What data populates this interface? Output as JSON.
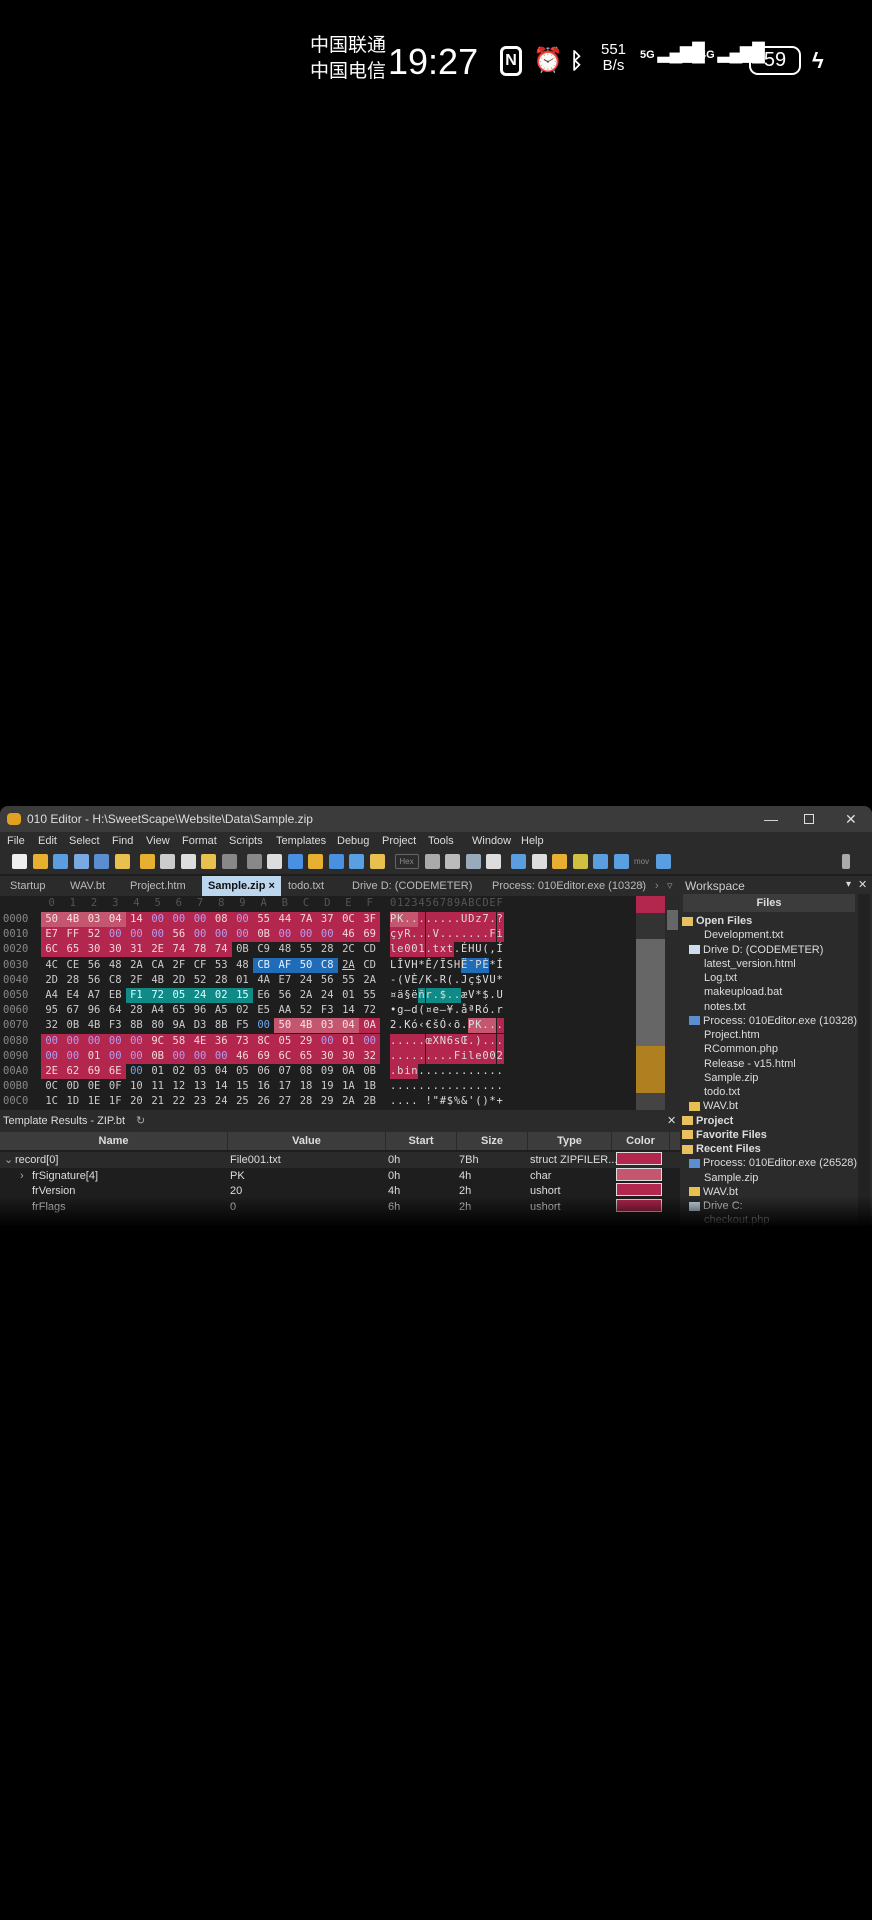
{
  "status_bar": {
    "carrier1": "中国联通",
    "carrier2": "中国电信",
    "time": "19:27",
    "net_speed_value": "551",
    "net_speed_unit": "B/s",
    "sig1": "5G",
    "sig2": "4G",
    "battery": "59"
  },
  "window": {
    "title": "010 Editor - H:\\SweetScape\\Website\\Data\\Sample.zip"
  },
  "menu": [
    "File",
    "Edit",
    "Select",
    "Find",
    "View",
    "Format",
    "Scripts",
    "Templates",
    "Debug",
    "Project",
    "Tools",
    "Window",
    "Help"
  ],
  "toolbar": {
    "hex_label": "Hex",
    "mov_label": "mov"
  },
  "tabs": [
    {
      "label": "Startup"
    },
    {
      "label": "WAV.bt"
    },
    {
      "label": "Project.htm"
    },
    {
      "label": "Sample.zip ×",
      "active": true
    },
    {
      "label": "todo.txt"
    },
    {
      "label": "Drive D: (CODEMETER)"
    },
    {
      "label": "Process: 010Editor.exe (10328)"
    }
  ],
  "hex": {
    "col_header": [
      "0",
      "1",
      "2",
      "3",
      "4",
      "5",
      "6",
      "7",
      "8",
      "9",
      "A",
      "B",
      "C",
      "D",
      "E",
      "F"
    ],
    "text_header": "0123456789ABCDEF",
    "rows": [
      {
        "offset": "0000",
        "bytes": [
          "50",
          "4B",
          "03",
          "04",
          "14",
          "00",
          "00",
          "00",
          "08",
          "00",
          "55",
          "44",
          "7A",
          "37",
          "0C",
          "3F"
        ],
        "text": "PK........UDz7.?"
      },
      {
        "offset": "0010",
        "bytes": [
          "E7",
          "FF",
          "52",
          "00",
          "00",
          "00",
          "56",
          "00",
          "00",
          "00",
          "0B",
          "00",
          "00",
          "00",
          "46",
          "69"
        ],
        "text": "çyR...V.......Fi"
      },
      {
        "offset": "0020",
        "bytes": [
          "6C",
          "65",
          "30",
          "30",
          "31",
          "2E",
          "74",
          "78",
          "74",
          "0B",
          "C9",
          "48",
          "55",
          "28",
          "2C",
          "CD"
        ],
        "text": "le001.txt.ÉHU(,Í"
      },
      {
        "offset": "0030",
        "bytes": [
          "4C",
          "CE",
          "56",
          "48",
          "2A",
          "CA",
          "2F",
          "CF",
          "53",
          "48",
          "CB",
          "AF",
          "50",
          "C8",
          "2A",
          "CD"
        ],
        "text": "LÎVH*Ê/ÏSHË¯PÈ*Í"
      },
      {
        "offset": "0040",
        "bytes": [
          "2D",
          "28",
          "56",
          "C8",
          "2F",
          "4B",
          "2D",
          "52",
          "28",
          "01",
          "4A",
          "E7",
          "24",
          "56",
          "55",
          "2A"
        ],
        "text": "-(VÈ/K-R(.Jç$VU*"
      },
      {
        "offset": "0050",
        "bytes": [
          "A4",
          "E4",
          "A7",
          "EB",
          "F1",
          "72",
          "05",
          "24",
          "02",
          "15",
          "E6",
          "56",
          "2A",
          "24",
          "01",
          "55"
        ],
        "text": "¤ä§ëñr.$..æV*$.U"
      },
      {
        "offset": "0060",
        "bytes": [
          "95",
          "67",
          "96",
          "64",
          "28",
          "A4",
          "65",
          "96",
          "A5",
          "02",
          "E5",
          "AA",
          "52",
          "F3",
          "14",
          "72"
        ],
        "text": "•g–d(¤e–¥.åªRó.r"
      },
      {
        "offset": "0070",
        "bytes": [
          "32",
          "0B",
          "4B",
          "F3",
          "8B",
          "80",
          "9A",
          "D3",
          "8B",
          "F5",
          "00",
          "50",
          "4B",
          "03",
          "04",
          "0A"
        ],
        "text": "2.Kó‹€šÓ‹õ.PK..."
      },
      {
        "offset": "0080",
        "bytes": [
          "00",
          "00",
          "00",
          "00",
          "00",
          "9C",
          "58",
          "4E",
          "36",
          "73",
          "8C",
          "05",
          "29",
          "00",
          "01",
          "00"
        ],
        "text": ".....œXN6sŒ.)..."
      },
      {
        "offset": "0090",
        "bytes": [
          "00",
          "00",
          "01",
          "00",
          "00",
          "0B",
          "00",
          "00",
          "00",
          "46",
          "69",
          "6C",
          "65",
          "30",
          "30",
          "32"
        ],
        "text": ".........File002"
      },
      {
        "offset": "00A0",
        "bytes": [
          "2E",
          "62",
          "69",
          "6E",
          "00",
          "01",
          "02",
          "03",
          "04",
          "05",
          "06",
          "07",
          "08",
          "09",
          "0A",
          "0B"
        ],
        "text": ".bin............"
      },
      {
        "offset": "00B0",
        "bytes": [
          "0C",
          "0D",
          "0E",
          "0F",
          "10",
          "11",
          "12",
          "13",
          "14",
          "15",
          "16",
          "17",
          "18",
          "19",
          "1A",
          "1B"
        ],
        "text": "................"
      },
      {
        "offset": "00C0",
        "bytes": [
          "1C",
          "1D",
          "1E",
          "1F",
          "20",
          "21",
          "22",
          "23",
          "24",
          "25",
          "26",
          "27",
          "28",
          "29",
          "2A",
          "2B"
        ],
        "text": ".... !\"#$%&'()*+"
      }
    ],
    "highlights": [
      {
        "row": 0,
        "from": 0,
        "to": 3,
        "kind": "lpink"
      },
      {
        "row": 0,
        "from": 4,
        "to": 15,
        "kind": "pink"
      },
      {
        "row": 1,
        "from": 0,
        "to": 15,
        "kind": "pink"
      },
      {
        "row": 2,
        "from": 0,
        "to": 8,
        "kind": "pink"
      },
      {
        "row": 3,
        "from": 10,
        "to": 13,
        "kind": "blue"
      },
      {
        "row": 5,
        "from": 4,
        "to": 9,
        "kind": "teal"
      },
      {
        "row": 7,
        "from": 11,
        "to": 14,
        "kind": "lpink"
      },
      {
        "row": 7,
        "from": 15,
        "to": 15,
        "kind": "pink"
      },
      {
        "row": 8,
        "from": 0,
        "to": 15,
        "kind": "pink"
      },
      {
        "row": 9,
        "from": 0,
        "to": 15,
        "kind": "pink"
      },
      {
        "row": 10,
        "from": 0,
        "to": 3,
        "kind": "pink"
      }
    ]
  },
  "template_results": {
    "title": "Template Results - ZIP.bt",
    "columns": [
      "Name",
      "Value",
      "Start",
      "Size",
      "Type",
      "Color"
    ],
    "rows": [
      {
        "expander": "v",
        "name": "record[0]",
        "value": "File001.txt",
        "start": "0h",
        "size": "7Bh",
        "type": "struct ZIPFILER...",
        "color": "#b3264e"
      },
      {
        "expander": ">",
        "name": "frSignature[4]",
        "value": "PK",
        "start": "0h",
        "size": "4h",
        "type": "char",
        "color": "#c4566f"
      },
      {
        "expander": "",
        "name": "frVersion",
        "value": "20",
        "start": "4h",
        "size": "2h",
        "type": "ushort",
        "color": "#b3264e"
      },
      {
        "expander": "",
        "name": "frFlags",
        "value": "0",
        "start": "6h",
        "size": "2h",
        "type": "ushort",
        "color": "#b3264e"
      }
    ]
  },
  "workspace": {
    "title": "Workspace",
    "files_header": "Files",
    "items": [
      {
        "label": "Open Files",
        "level": 0,
        "bold": true,
        "icon": "folder-open-icon"
      },
      {
        "label": "Development.txt",
        "level": 1
      },
      {
        "label": "Drive D: (CODEMETER)",
        "level": 1,
        "icon": "drive-icon"
      },
      {
        "label": "latest_version.html",
        "level": 1
      },
      {
        "label": "Log.txt",
        "level": 1
      },
      {
        "label": "makeupload.bat",
        "level": 1
      },
      {
        "label": "notes.txt",
        "level": 1
      },
      {
        "label": "Process: 010Editor.exe (10328)",
        "level": 1,
        "icon": "process-icon"
      },
      {
        "label": "Project.htm",
        "level": 1
      },
      {
        "label": "RCommon.php",
        "level": 1
      },
      {
        "label": "Release - v15.html",
        "level": 1
      },
      {
        "label": "Sample.zip",
        "level": 1
      },
      {
        "label": "todo.txt",
        "level": 1
      },
      {
        "label": "WAV.bt",
        "level": 1,
        "icon": "template-icon"
      },
      {
        "label": "Project",
        "level": 0,
        "bold": true,
        "icon": "project-folder-icon"
      },
      {
        "label": "Favorite Files",
        "level": 0,
        "bold": true,
        "icon": "favorite-folder-icon"
      },
      {
        "label": "Recent Files",
        "level": 0,
        "bold": true,
        "icon": "recent-folder-icon"
      },
      {
        "label": "Process: 010Editor.exe (26528)",
        "level": 1,
        "icon": "process-icon"
      },
      {
        "label": "Sample.zip",
        "level": 1
      },
      {
        "label": "WAV.bt",
        "level": 1,
        "icon": "template-icon"
      },
      {
        "label": "Drive C:",
        "level": 1,
        "icon": "drive-icon"
      },
      {
        "label": "checkout.php",
        "level": 1
      }
    ]
  }
}
